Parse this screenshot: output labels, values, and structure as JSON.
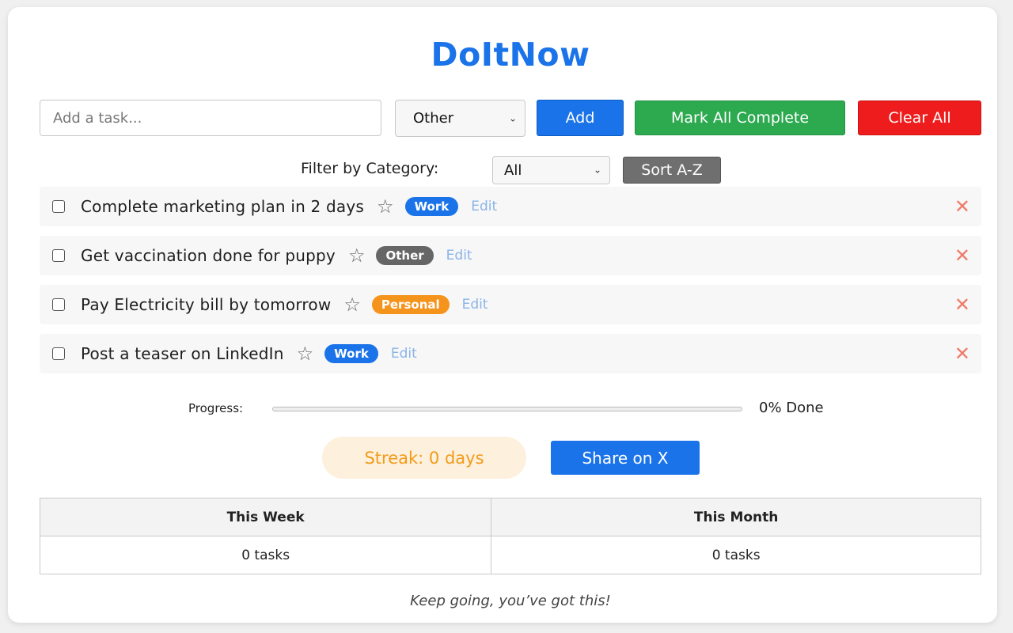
{
  "app": {
    "title": "DoItNow"
  },
  "add_form": {
    "input_placeholder": "Add a task...",
    "input_value": "",
    "category_selected": "Other",
    "add_label": "Add",
    "mark_all_label": "Mark All Complete",
    "clear_all_label": "Clear All"
  },
  "filter": {
    "label": "Filter by Category:",
    "selected": "All",
    "sort_label": "Sort A-Z"
  },
  "tasks": [
    {
      "text": "Complete marketing plan in 2 days",
      "category": "Work",
      "category_color": "#1a73e8",
      "edit_label": "Edit",
      "checked": false
    },
    {
      "text": "Get vaccination done for puppy",
      "category": "Other",
      "category_color": "#666666",
      "edit_label": "Edit",
      "checked": false
    },
    {
      "text": "Pay Electricity bill by tomorrow",
      "category": "Personal",
      "category_color": "#f5941d",
      "edit_label": "Edit",
      "checked": false
    },
    {
      "text": "Post a teaser on LinkedIn",
      "category": "Work",
      "category_color": "#1a73e8",
      "edit_label": "Edit",
      "checked": false
    }
  ],
  "icons": {
    "star": "star-outline-icon",
    "delete": "close-x-icon",
    "chevron": "chevron-down-icon"
  },
  "progress": {
    "label": "Progress:",
    "percent": 0,
    "text": "0% Done"
  },
  "streak": {
    "text": "Streak: 0 days"
  },
  "share": {
    "label": "Share on X"
  },
  "stats": {
    "headers": [
      "This Week",
      "This Month"
    ],
    "values": [
      "0 tasks",
      "0 tasks"
    ]
  },
  "footer": {
    "motivation": "Keep going, you’ve got this!"
  },
  "colors": {
    "primary": "#1a73e8",
    "success": "#2da94f",
    "danger": "#ee1c1c",
    "sort": "#6f6f6f",
    "streak_text": "#f29b1a",
    "streak_bg": "#fdf0dc"
  }
}
